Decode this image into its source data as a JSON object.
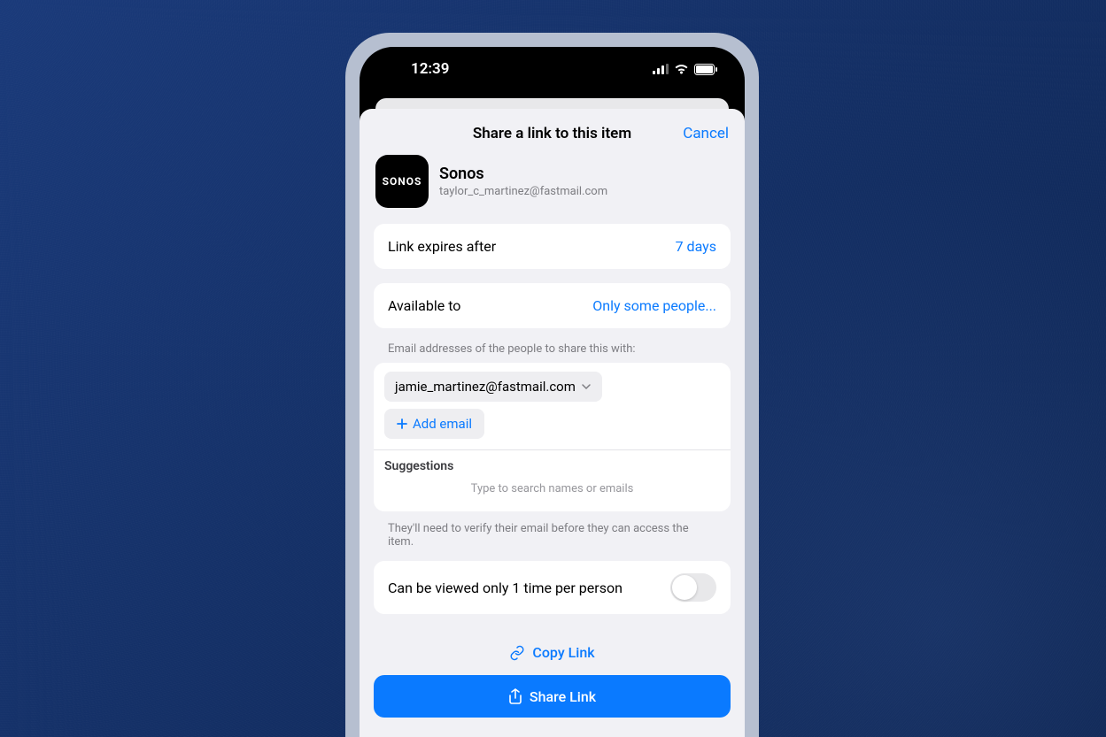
{
  "statusBar": {
    "time": "12:39"
  },
  "sheet": {
    "title": "Share a link to this item",
    "cancel": "Cancel"
  },
  "item": {
    "logoText": "SONOS",
    "name": "Sonos",
    "subtitle": "taylor_c_martinez@fastmail.com"
  },
  "expiry": {
    "label": "Link expires after",
    "value": "7 days"
  },
  "availability": {
    "label": "Available to",
    "value": "Only some people..."
  },
  "emails": {
    "sectionLabel": "Email addresses of the people to share this with:",
    "list": [
      "jamie_martinez@fastmail.com"
    ],
    "addLabel": "Add email",
    "suggestionsTitle": "Suggestions",
    "suggestionsHint": "Type to search names or emails",
    "helpText": "They'll need to verify their email before they can access the item."
  },
  "viewOnce": {
    "label": "Can be viewed only 1 time per person",
    "enabled": false
  },
  "actions": {
    "copy": "Copy Link",
    "share": "Share Link"
  }
}
